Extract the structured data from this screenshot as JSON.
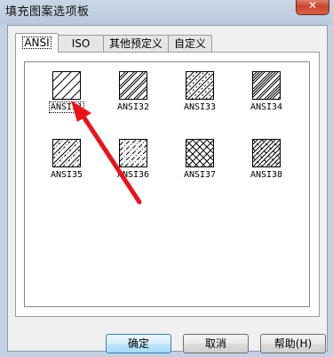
{
  "window": {
    "title": "填充图案选项板"
  },
  "tabs": [
    {
      "label": "ANSI",
      "active": true
    },
    {
      "label": "ISO",
      "active": false
    },
    {
      "label": "其他预定义",
      "active": false
    },
    {
      "label": "自定义",
      "active": false
    }
  ],
  "patterns": [
    {
      "label": "ANSI31",
      "hatch": "single",
      "selected": true
    },
    {
      "label": "ANSI32",
      "hatch": "double",
      "selected": false
    },
    {
      "label": "ANSI33",
      "hatch": "dash",
      "selected": false
    },
    {
      "label": "ANSI34",
      "hatch": "dense",
      "selected": false
    },
    {
      "label": "ANSI35",
      "hatch": "dash-double",
      "selected": false
    },
    {
      "label": "ANSI36",
      "hatch": "dashed",
      "selected": false
    },
    {
      "label": "ANSI37",
      "hatch": "cross",
      "selected": false
    },
    {
      "label": "ANSI38",
      "hatch": "cross-dense",
      "selected": false
    }
  ],
  "buttons": {
    "ok": "确定",
    "cancel": "取消",
    "help": "帮助(H)"
  },
  "colors": {
    "arrow": "#e8141a",
    "titlebar": "#c9d6e6",
    "close": "#c9462e"
  }
}
